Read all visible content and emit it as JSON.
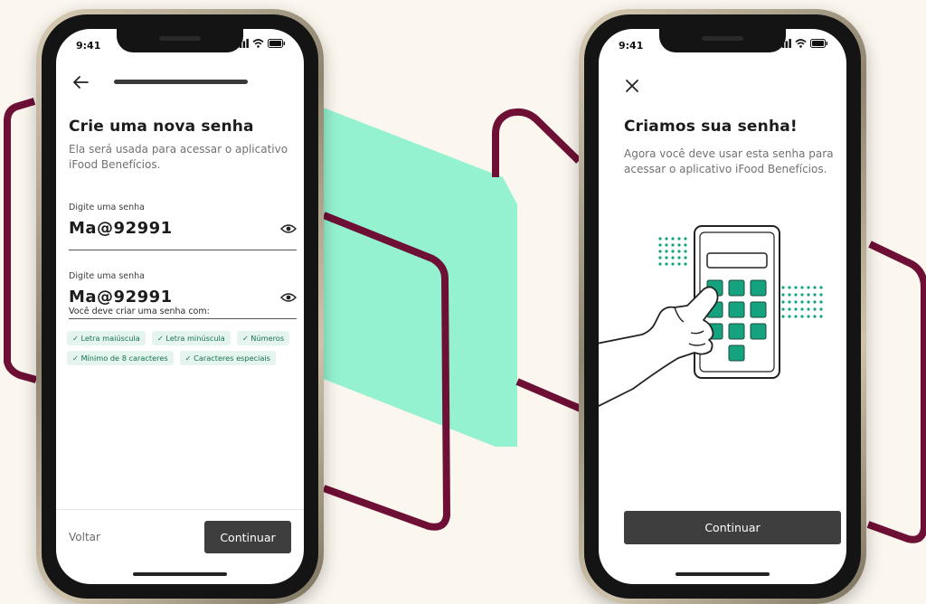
{
  "colors": {
    "background": "#fbf6ee",
    "teal_shape": "#94f2d0",
    "maroon_line": "#6e0f35",
    "button_dark": "#3e3e3e",
    "chip_bg": "#e5f4ee",
    "chip_text": "#17744f",
    "keypad_green": "#14a37e"
  },
  "left_phone": {
    "status_time": "9:41",
    "back_icon": "arrow-left-icon",
    "title": "Crie uma nova senha",
    "subtitle": "Ela será usada para acessar o aplicativo iFood Benefícios.",
    "fields": [
      {
        "label": "Digite uma senha",
        "value": "Ma@92991",
        "icon": "eye-icon"
      },
      {
        "label": "Digite uma senha",
        "value": "Ma@92991",
        "icon": "eye-icon"
      }
    ],
    "requirements_title": "Você deve criar uma senha com:",
    "requirements": [
      "✓ Letra maiúscula",
      "✓ Letra minúscula",
      "✓ Números",
      "✓ Mínimo de 8 caracteres",
      "✓ Caracteres especiais"
    ],
    "back_label": "Voltar",
    "continue_label": "Continuar"
  },
  "right_phone": {
    "status_time": "9:41",
    "close_icon": "close-icon",
    "title": "Criamos sua senha!",
    "subtitle": "Agora você deve usar esta senha para acessar o aplicativo iFood Benefícios.",
    "illustration": "hand-pressing-keypad-illustration",
    "continue_label": "Continuar"
  }
}
